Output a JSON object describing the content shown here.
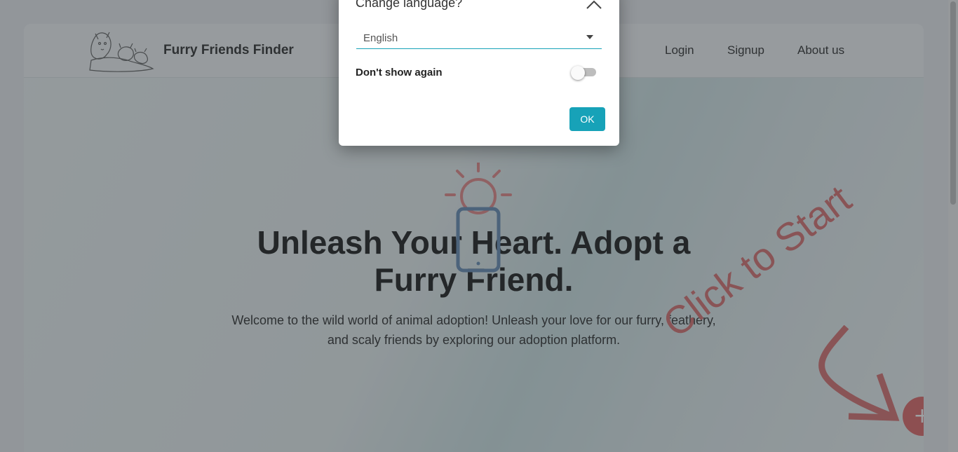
{
  "navbar": {
    "brand": "Furry Friends Finder",
    "links": [
      "Login",
      "Signup",
      "About us"
    ]
  },
  "hero": {
    "title_line1": "Unleash Your Heart. Adopt a",
    "title_line2": "Furry Friend.",
    "subtitle_line1": "Welcome to the wild world of animal adoption! Unleash your love for our furry, feathery,",
    "subtitle_line2": "and scaly friends by exploring our adoption platform."
  },
  "hint": {
    "text": "Click to Start",
    "fab_label": "+"
  },
  "dialog": {
    "title": "Change language?",
    "selected_language": "English",
    "toggle_label": "Don't show again",
    "toggle_on": false,
    "ok_label": "OK"
  },
  "icons": {
    "logo": "pets-logo-icon",
    "close": "chevron-up-icon",
    "caret": "caret-down-icon",
    "hint": "lightbulb-phone-icon"
  },
  "colors": {
    "accent": "#17a2b8",
    "fab": "#e06b6b",
    "hint": "#d97373"
  }
}
